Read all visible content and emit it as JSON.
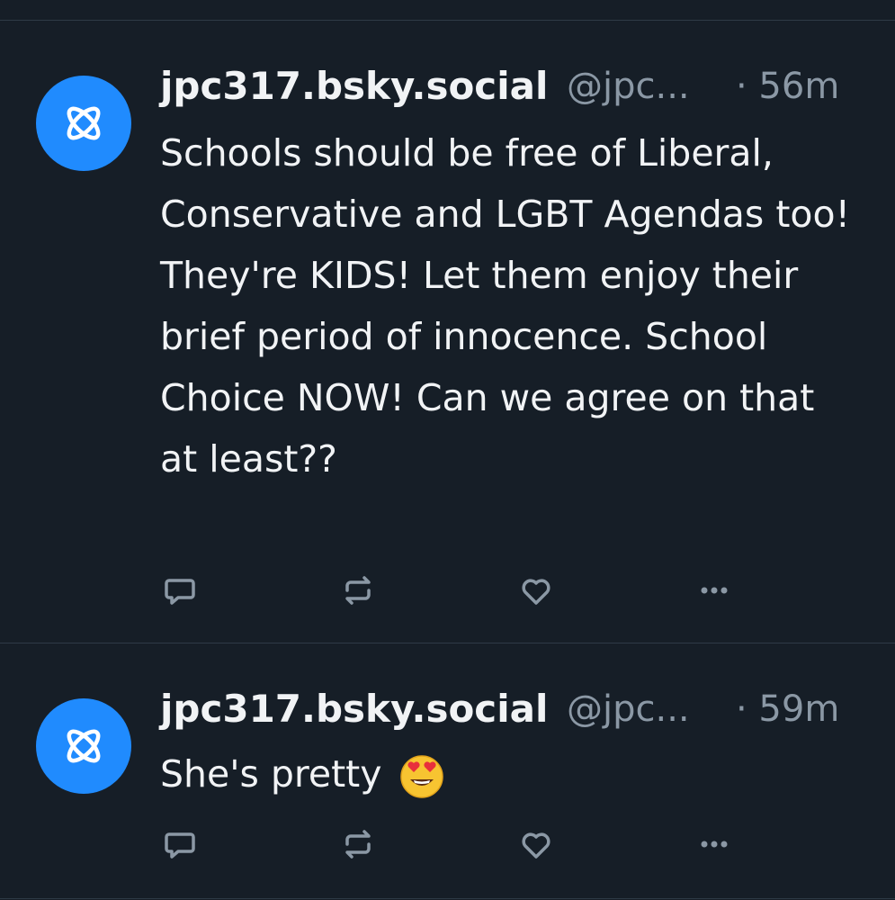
{
  "feed": {
    "posts": [
      {
        "display_name": "jpc317.bsky.social",
        "handle": "@jpc...",
        "time": "· 56m",
        "text": "Schools should be free of Liberal, Conservative and LGBT Agendas too! They're KIDS! Let them enjoy their brief period of innocence. School Choice NOW! Can we agree on that at least??",
        "avatar_icon": "atom-icon",
        "actions": [
          "reply-icon",
          "repost-icon",
          "like-icon",
          "more-icon"
        ]
      },
      {
        "display_name": "jpc317.bsky.social",
        "handle": "@jpc...",
        "time": "· 59m",
        "text": "She's pretty",
        "emoji": "heart-eyes-emoji",
        "avatar_icon": "atom-icon",
        "actions": [
          "reply-icon",
          "repost-icon",
          "like-icon",
          "more-icon"
        ]
      }
    ]
  },
  "colors": {
    "background": "#161e27",
    "avatar": "#208bfe",
    "muted_text": "#8b98a5",
    "primary_text": "#f1f3f5",
    "divider": "#2e3a46"
  }
}
